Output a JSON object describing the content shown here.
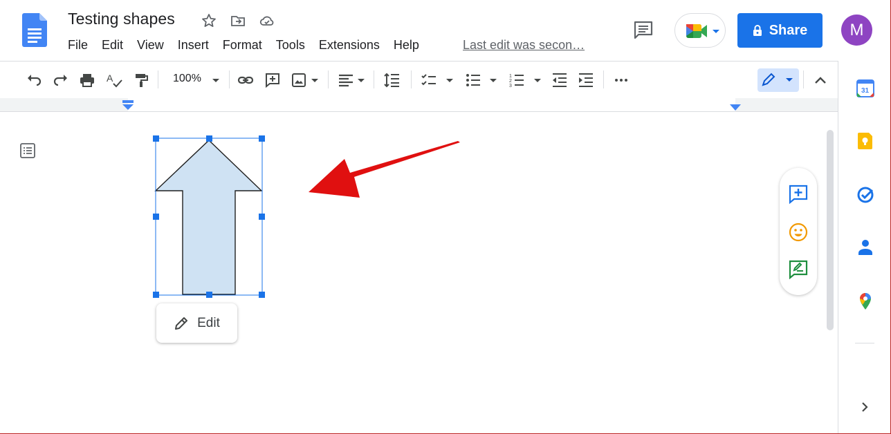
{
  "document": {
    "title": "Testing shapes",
    "last_edit": "Last edit was secon…"
  },
  "menu": [
    "File",
    "Edit",
    "View",
    "Insert",
    "Format",
    "Tools",
    "Extensions",
    "Help"
  ],
  "share": {
    "label": "Share"
  },
  "avatar": {
    "initial": "M",
    "color": "#8e44c2"
  },
  "toolbar": {
    "zoom": "100%"
  },
  "shape": {
    "edit_label": "Edit",
    "fill": "#cfe2f3"
  },
  "colors": {
    "accent": "#1a73e8",
    "annotation_arrow": "#e01010"
  }
}
